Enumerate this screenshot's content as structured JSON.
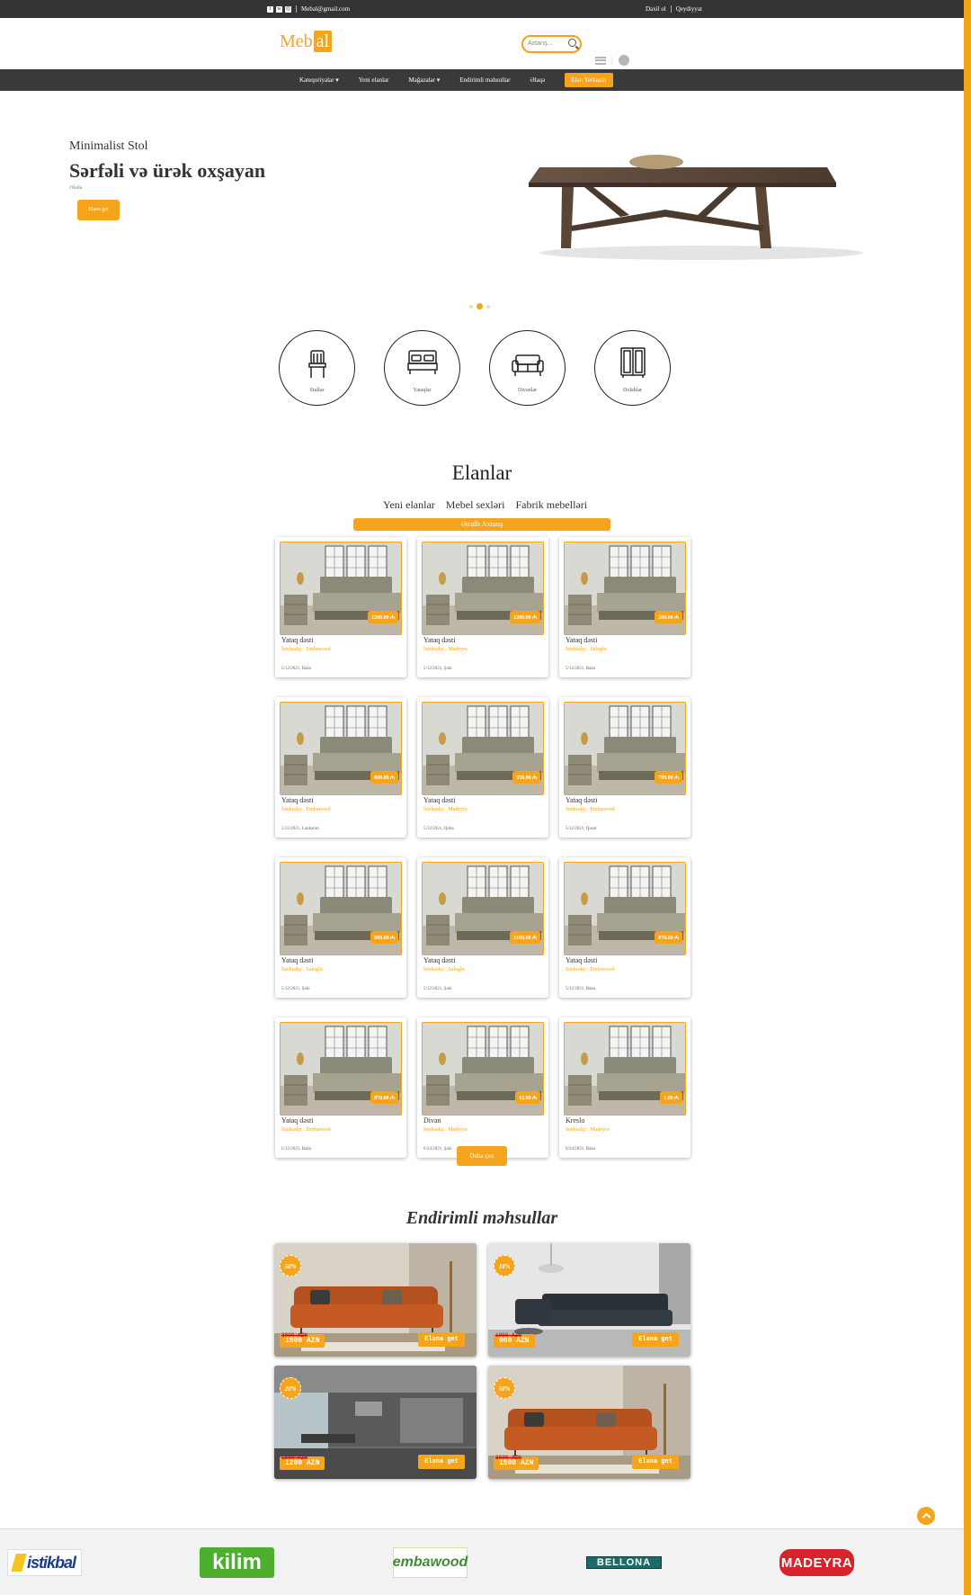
{
  "topbar": {
    "email": "Mebal@gmail.com",
    "login": "Daxil ol",
    "register": "Qeydiyyat"
  },
  "header": {
    "logo_left": "Meb",
    "logo_box": "al",
    "search_placeholder": "Axtarış..."
  },
  "nav": {
    "items": [
      "Kateqoriyalar",
      "Yeni elanlar",
      "Mağazalar",
      "Endirimli məhsullar",
      "Əlaqə"
    ],
    "cta": "Elan Yerləşdir"
  },
  "hero": {
    "subtitle": "Minimalist Stol",
    "title": "Sərfəli və ürək oxşayan",
    "small": "Əlada",
    "button": "Elana get"
  },
  "categories": [
    {
      "label": "Stullar",
      "icon": "chair-icon"
    },
    {
      "label": "Yataqlar",
      "icon": "bed-icon"
    },
    {
      "label": "Divanlar",
      "icon": "sofa-icon"
    },
    {
      "label": "Dolablar",
      "icon": "wardrobe-icon"
    }
  ],
  "listings": {
    "title": "Elanlar",
    "tabs": [
      "Yeni elanlar",
      "Mebel sexləri",
      "Fabrik mebelləri"
    ],
    "advanced_search": "Ətraflı Axtarış",
    "more_button": "Daha çox",
    "items": [
      {
        "price": "1200.00 ₼",
        "name": "Yataq dəsti",
        "maker": "İstehsalçı : Embawood",
        "date": "5/12/2021, Baku"
      },
      {
        "price": "1200.00 ₼",
        "name": "Yataq dəsti",
        "maker": "İstehsalçı : Madeyra",
        "date": "5/12/2021, Şəki"
      },
      {
        "price": "200.00 ₼",
        "name": "Yataq dəsti",
        "maker": "İstehsalçı : Saloglu",
        "date": "5/12/2021, Baku"
      },
      {
        "price": "800.00 ₼",
        "name": "Yataq dəsti",
        "maker": "İstehsalçı : Embawood",
        "date": "5/12/2021, Lənkəran"
      },
      {
        "price": "550.00 ₼",
        "name": "Yataq dəsti",
        "maker": "İstehsalçı : Madeyra",
        "date": "5/12/2021, Quba"
      },
      {
        "price": "789.00 ₼",
        "name": "Yataq dəsti",
        "maker": "İstehsalçı : Embawood",
        "date": "5/12/2021, Qusar"
      },
      {
        "price": "960.00 ₼",
        "name": "Yataq dəsti",
        "maker": "İstehsalçı : Saloglu",
        "date": "5/12/2021, Şəki"
      },
      {
        "price": "2100.00 ₼",
        "name": "Yataq dəsti",
        "maker": "İstehsalçı : Saloglu",
        "date": "5/12/2021, Şəki"
      },
      {
        "price": "870.00 ₼",
        "name": "Yataq dəsti",
        "maker": "İstehsalçı : Embawood",
        "date": "5/12/2021, Baku"
      },
      {
        "price": "870.00 ₼",
        "name": "Yataq dəsti",
        "maker": "İstehsalçı : Embawood",
        "date": "5/12/2021, Baku"
      },
      {
        "price": "12.00 ₼",
        "name": "Divan",
        "maker": "İstehsalçı : Madeyra",
        "date": "6/24/2021, Şəki"
      },
      {
        "price": "1.00 ₼",
        "name": "Kreslo",
        "maker": "İstehsalçı : Madeyra",
        "date": "6/24/2021, Baku"
      }
    ]
  },
  "discounts": {
    "title": "Endirimli məhsullar",
    "items": [
      {
        "badge": "50%",
        "old_price": "3000 AZN",
        "new_price": "1500 AZN",
        "button": "Elana get",
        "scene": "orange-sofa"
      },
      {
        "badge": "10%",
        "old_price": "1000 AZN",
        "new_price": "900 AZN",
        "button": "Elana get",
        "scene": "dark-sofa"
      },
      {
        "badge": "20%",
        "old_price": "1500 AZN",
        "new_price": "1200 AZN",
        "button": "Elana get",
        "scene": "kitchen"
      },
      {
        "badge": "50%",
        "old_price": "3000 AZN",
        "new_price": "1500 AZN",
        "button": "Elana get",
        "scene": "orange-sofa"
      }
    ]
  },
  "brands": [
    "istikbal",
    "kilim",
    "embawood",
    "BELLONA",
    "MADEYRA"
  ],
  "colors": {
    "accent": "#f7a41d",
    "dark": "#343434"
  }
}
